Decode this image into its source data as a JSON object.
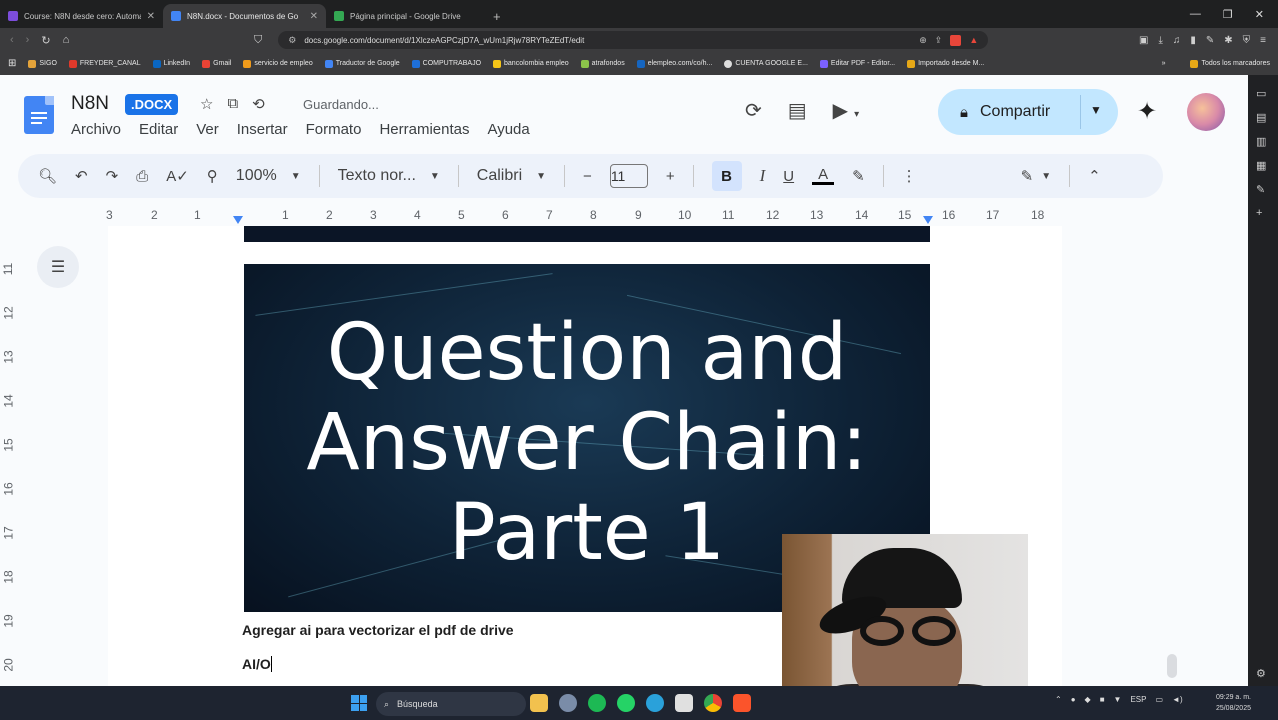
{
  "browser": {
    "tabs": [
      {
        "title": "Course: N8N desde cero: Automatiz",
        "icon_color": "#7c4ddb",
        "active": false
      },
      {
        "title": "N8N.docx - Documentos de Go",
        "icon_color": "#4285f4",
        "active": true
      },
      {
        "title": "Página principal - Google Drive",
        "icon_color": "#34a853",
        "active": false
      }
    ],
    "url": "docs.google.com/document/d/1XlczeAGPCzjD7A_wUm1jRjw78RYTeZEdT/edit",
    "bookmarks": [
      {
        "label": "SIGO",
        "color": "#e4a33a"
      },
      {
        "label": "FREYDER_CANAL",
        "color": "#e0392b"
      },
      {
        "label": "LinkedIn",
        "color": "#0a66c2"
      },
      {
        "label": "Gmail",
        "color": "#ea4335"
      },
      {
        "label": "servicio de empleo",
        "color": "#f09b1b"
      },
      {
        "label": "Traductor de Google",
        "color": "#4285f4"
      },
      {
        "label": "COMPUTRABAJO",
        "color": "#1e6fd9"
      },
      {
        "label": "bancolombia empleo",
        "color": "#f5c518"
      },
      {
        "label": "atrafondos",
        "color": "#8bc34a"
      },
      {
        "label": "elempleo.com/co/h...",
        "color": "#1565c0"
      },
      {
        "label": "CUENTA GOOGLE E...",
        "color": "#dddddd"
      },
      {
        "label": "Editar PDF - Editor...",
        "color": "#7b61ff"
      },
      {
        "label": "Importado desde M...",
        "color": "#e6a817"
      }
    ],
    "bookmarks_all": "Todos los marcadores"
  },
  "doc": {
    "title": "N8N",
    "badge": ".DOCX",
    "status": "Guardando...",
    "menu": [
      "Archivo",
      "Editar",
      "Ver",
      "Insertar",
      "Formato",
      "Herramientas",
      "Ayuda"
    ],
    "share_label": "Compartir",
    "toolbar": {
      "zoom": "100%",
      "style": "Texto nor...",
      "font": "Calibri",
      "font_size": "11",
      "bold": "B",
      "italic": "I",
      "underline": "U",
      "text_color": "A"
    },
    "ruler_h": [
      "3",
      "2",
      "1",
      "1",
      "2",
      "3",
      "4",
      "5",
      "6",
      "7",
      "8",
      "9",
      "10",
      "11",
      "12",
      "13",
      "14",
      "15",
      "16",
      "17",
      "18"
    ],
    "ruler_v": [
      "11",
      "12",
      "13",
      "14",
      "15",
      "16",
      "17",
      "18",
      "19",
      "20"
    ],
    "banner_lines": [
      "Question and",
      "Answer Chain:",
      "Parte 1"
    ],
    "paragraph1": "Agregar ai para vectorizar el pdf de drive",
    "paragraph2": "AI/O"
  },
  "taskbar": {
    "search_placeholder": "Búsqueda",
    "lang": "ESP",
    "time": "09:29 a. m.",
    "date": "25/08/2025"
  },
  "colors": {
    "accent": "#1a73e8",
    "share_bg": "#c2e7ff",
    "toolbar_bg": "#edf2fa"
  }
}
